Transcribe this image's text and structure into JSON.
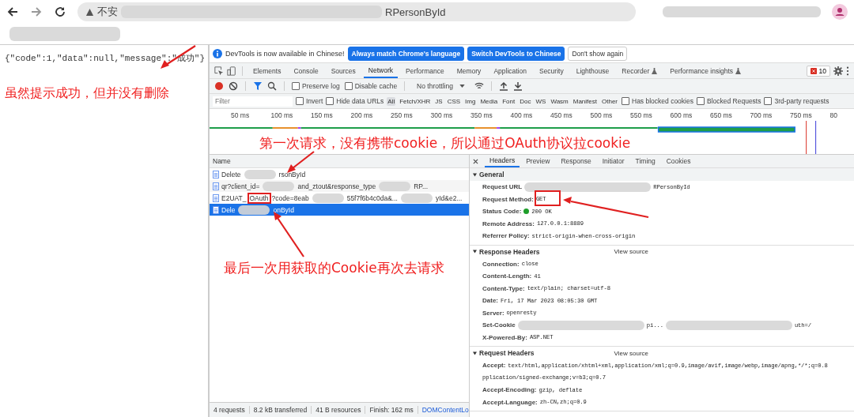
{
  "browser": {
    "address": {
      "prefix": "不安",
      "suffix": "RPersonById"
    }
  },
  "page": {
    "response_text": "{\"code\":1,\"data\":null,\"message\":\"成功\"}"
  },
  "annotations": [
    {
      "text": "虽然提示成功，但并没有删除"
    },
    {
      "text": "第一次请求，没有携带cookie，所以通过OAuth协议拉cookie"
    },
    {
      "text": "最后一次用获取的Cookie再次去请求"
    }
  ],
  "devtools": {
    "info_bar": {
      "message": "DevTools is now available in Chinese!",
      "buttons": [
        {
          "label": "Always match Chrome's language",
          "kind": "primary"
        },
        {
          "label": "Switch DevTools to Chinese",
          "kind": "primary"
        },
        {
          "label": "Don't show again",
          "kind": "plain"
        }
      ]
    },
    "panel_tabs": [
      {
        "label": "Elements",
        "selected": false,
        "experimental": false
      },
      {
        "label": "Console",
        "selected": false,
        "experimental": false
      },
      {
        "label": "Sources",
        "selected": false,
        "experimental": false
      },
      {
        "label": "Network",
        "selected": true,
        "experimental": false
      },
      {
        "label": "Performance",
        "selected": false,
        "experimental": false
      },
      {
        "label": "Memory",
        "selected": false,
        "experimental": false
      },
      {
        "label": "Application",
        "selected": false,
        "experimental": false
      },
      {
        "label": "Security",
        "selected": false,
        "experimental": false
      },
      {
        "label": "Lighthouse",
        "selected": false,
        "experimental": false
      },
      {
        "label": "Recorder",
        "selected": false,
        "experimental": true
      },
      {
        "label": "Performance insights",
        "selected": false,
        "experimental": true
      }
    ],
    "issues_count": "10",
    "toolbar": {
      "checkboxes": [
        {
          "label": "Preserve log",
          "checked": false
        },
        {
          "label": "Disable cache",
          "checked": false
        }
      ],
      "throttling": "No throttling"
    },
    "filter": {
      "placeholder": "Filter",
      "options": [
        {
          "label": "Invert",
          "checked": false
        },
        {
          "label": "Hide data URLs",
          "checked": false
        }
      ],
      "types": [
        {
          "label": "All",
          "selected": true
        },
        {
          "label": "Fetch/XHR",
          "selected": false
        },
        {
          "label": "JS",
          "selected": false
        },
        {
          "label": "CSS",
          "selected": false
        },
        {
          "label": "Img",
          "selected": false
        },
        {
          "label": "Media",
          "selected": false
        },
        {
          "label": "Font",
          "selected": false
        },
        {
          "label": "Doc",
          "selected": false
        },
        {
          "label": "WS",
          "selected": false
        },
        {
          "label": "Wasm",
          "selected": false
        },
        {
          "label": "Manifest",
          "selected": false
        },
        {
          "label": "Other",
          "selected": false
        }
      ],
      "more_options": [
        {
          "label": "Has blocked cookies",
          "checked": false
        },
        {
          "label": "Blocked Requests",
          "checked": false
        },
        {
          "label": "3rd-party requests",
          "checked": false
        }
      ]
    },
    "timeline": {
      "ticks": [
        "50 ms",
        "100 ms",
        "150 ms",
        "200 ms",
        "250 ms",
        "300 ms",
        "350 ms",
        "400 ms",
        "450 ms",
        "500 ms",
        "550 ms",
        "600 ms",
        "650 ms",
        "700 ms",
        "750 ms",
        "80"
      ]
    },
    "requests": {
      "column": "Name",
      "rows": [
        {
          "parts": [
            {
              "text": "Delete",
              "blur_before": false,
              "highlighted": false
            },
            {
              "text": "rsonById",
              "blur_before": true,
              "highlighted": false
            }
          ],
          "selected": false
        },
        {
          "parts": [
            {
              "text": "qr?client_id=",
              "blur_before": false,
              "highlighted": false
            },
            {
              "text": "and_ztout&response_type",
              "blur_before": true,
              "highlighted": false
            },
            {
              "text": "RP...",
              "blur_before": true,
              "highlighted": false
            }
          ],
          "selected": false
        },
        {
          "parts": [
            {
              "text": "E2UAT_",
              "blur_before": false,
              "highlighted": false
            },
            {
              "text": "OAuth",
              "blur_before": false,
              "highlighted": true
            },
            {
              "text": "?code=8eab",
              "blur_before": false,
              "highlighted": false
            },
            {
              "text": "55f7f6b4c0da&...",
              "blur_before": true,
              "highlighted": false
            },
            {
              "text": "yId&e2...",
              "blur_before": true,
              "highlighted": false
            }
          ],
          "selected": false
        },
        {
          "parts": [
            {
              "text": "Dele",
              "blur_before": false,
              "highlighted": false
            },
            {
              "text": "onById",
              "blur_before": true,
              "highlighted": false
            }
          ],
          "selected": true
        }
      ]
    },
    "status_bar": [
      "4 requests",
      "8.2 kB transferred",
      "41 B resources",
      "Finish: 162 ms",
      "DOMContentLo"
    ],
    "details": {
      "tabs": [
        {
          "label": "Headers",
          "selected": true
        },
        {
          "label": "Preview",
          "selected": false
        },
        {
          "label": "Response",
          "selected": false
        },
        {
          "label": "Initiator",
          "selected": false
        },
        {
          "label": "Timing",
          "selected": false
        },
        {
          "label": "Cookies",
          "selected": false
        }
      ],
      "sections": [
        {
          "title": "General",
          "expanded": true,
          "rows": [
            {
              "key": "Request URL",
              "value": [
                "RPersonById"
              ]
            },
            {
              "key": "Request Method:",
              "value": [
                "GET"
              ]
            },
            {
              "key": "Status Code:",
              "value": [
                "200 OK"
              ],
              "status": true
            },
            {
              "key": "Remote Address:",
              "value": [
                "127.0.0.1:8889"
              ]
            },
            {
              "key": "Referrer Policy:",
              "value": [
                "strict-origin-when-cross-origin"
              ]
            }
          ]
        },
        {
          "title": "Response Headers",
          "view_source": "View source",
          "expanded": true,
          "rows": [
            {
              "key": "Connection:",
              "value": [
                "close"
              ]
            },
            {
              "key": "Content-Length:",
              "value": [
                "41"
              ]
            },
            {
              "key": "Content-Type:",
              "value": [
                "text/plain; charset=utf-8"
              ]
            },
            {
              "key": "Date:",
              "value": [
                "Fri, 17 Mar 2023 08:05:30 GMT"
              ]
            },
            {
              "key": "Server:",
              "value": [
                "openresty"
              ]
            },
            {
              "key": "Set-Cookie",
              "value": [
                "pi...",
                "uth=/"
              ]
            },
            {
              "key": "X-Powered-By:",
              "value": [
                "ASP.NET"
              ]
            }
          ]
        },
        {
          "title": "Request Headers",
          "view_source": "View source",
          "expanded": true,
          "rows": [
            {
              "key": "Accept:",
              "value": [
                "text/html,application/xhtml+xml,application/xml;q=0.9,image/avif,image/webp,image/apng,*/*;q=0.8"
              ]
            },
            {
              "key": "",
              "value": [
                "pplication/signed-exchange;v=b3;q=0.7"
              ]
            },
            {
              "key": "Accept-Encoding:",
              "value": [
                "gzip, deflate"
              ]
            },
            {
              "key": "Accept-Language:",
              "value": [
                "zh-CN,zh;q=0.9"
              ]
            }
          ]
        }
      ]
    }
  }
}
